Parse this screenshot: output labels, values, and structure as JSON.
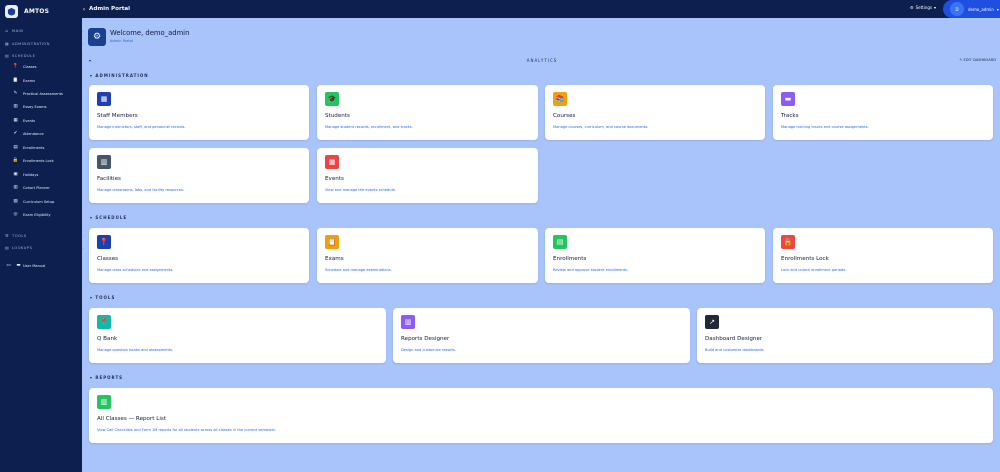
{
  "brand": {
    "name": "AMTOS"
  },
  "topbar": {
    "title": "Admin Portal",
    "settings_label": "Settings",
    "user_initial": "D",
    "user_name": "demo_admin"
  },
  "sidebar": {
    "sections": [
      {
        "label": "MAIN"
      },
      {
        "label": "ADMINISTRATION"
      },
      {
        "label": "SCHEDULE"
      },
      {
        "label": "TOOLS"
      },
      {
        "label": "LOOKUPS"
      }
    ],
    "items": [
      {
        "label": "Classes",
        "icon": "pin-icon"
      },
      {
        "label": "Exams",
        "icon": "clipboard-icon"
      },
      {
        "label": "Practical Assessments",
        "icon": "pencil-icon"
      },
      {
        "label": "Essay Exams",
        "icon": "document-icon"
      },
      {
        "label": "Events",
        "icon": "calendar-icon"
      },
      {
        "label": "Attendance",
        "icon": "check-icon"
      },
      {
        "label": "Enrollments",
        "icon": "list-icon"
      },
      {
        "label": "Enrollments Lock",
        "icon": "lock-icon"
      },
      {
        "label": "Holidays",
        "icon": "holiday-icon"
      },
      {
        "label": "Cohort Planner",
        "icon": "cohort-icon"
      },
      {
        "label": "Curriculum Setup",
        "icon": "settings-icon"
      },
      {
        "label": "Exam Eligibility",
        "icon": "circle-check-icon"
      }
    ],
    "user_manual": "User Manual"
  },
  "welcome": {
    "heading": "Welcome, demo_admin",
    "subtitle": "Admin Portal"
  },
  "analytics": {
    "label": "ANALYTICS",
    "edit_label": "EDIT DASHBOARD"
  },
  "sections": {
    "administration": {
      "label": "ADMINISTRATION",
      "cards": [
        {
          "title": "Staff Members",
          "desc": "Manage instructors, staff, and personnel records.",
          "icon": "staff-icon",
          "color": "#1e40af"
        },
        {
          "title": "Students",
          "desc": "Manage student records, enrollment, and tracks.",
          "icon": "graduation-cap-icon",
          "color": "#22c55e"
        },
        {
          "title": "Courses",
          "desc": "Manage courses, curriculum, and course documents.",
          "icon": "books-icon",
          "color": "#f59e0b"
        },
        {
          "title": "Tracks",
          "desc": "Manage training tracks and course assignments.",
          "icon": "tracks-icon",
          "color": "#8b5cf6"
        },
        {
          "title": "Facilities",
          "desc": "Manage classrooms, labs, and facility resources.",
          "icon": "building-icon",
          "color": "#475569"
        },
        {
          "title": "Events",
          "desc": "View and manage the events schedule.",
          "icon": "calendar-icon",
          "color": "#ef4444"
        }
      ]
    },
    "schedule": {
      "label": "SCHEDULE",
      "cards": [
        {
          "title": "Classes",
          "desc": "Manage class schedules and assignments.",
          "icon": "pin-icon",
          "color": "#1e40af"
        },
        {
          "title": "Exams",
          "desc": "Schedule and manage examinations.",
          "icon": "clipboard-icon",
          "color": "#f59e0b"
        },
        {
          "title": "Enrollments",
          "desc": "Review and approve student enrollments.",
          "icon": "list-check-icon",
          "color": "#22c55e"
        },
        {
          "title": "Enrollments Lock",
          "desc": "Lock and unlock enrollment periods.",
          "icon": "lock-icon",
          "color": "#ef4444"
        }
      ]
    },
    "tools": {
      "label": "TOOLS",
      "cards": [
        {
          "title": "Q Bank",
          "desc": "Manage question banks and assessments.",
          "icon": "pin-icon",
          "color": "#14b8a6"
        },
        {
          "title": "Reports Designer",
          "desc": "Design and customize reports.",
          "icon": "chart-icon",
          "color": "#8b5cf6"
        },
        {
          "title": "Dashboard Designer",
          "desc": "Build and customize dashboards.",
          "icon": "chart-up-icon",
          "color": "#1f2937"
        }
      ]
    },
    "reports": {
      "label": "REPORTS",
      "cards": [
        {
          "title": "All Classes — Report List",
          "desc": "View Call Checklists and Form 1M reports for all students across all classes in the current semester.",
          "icon": "chart-icon",
          "color": "#22c55e"
        }
      ]
    }
  }
}
